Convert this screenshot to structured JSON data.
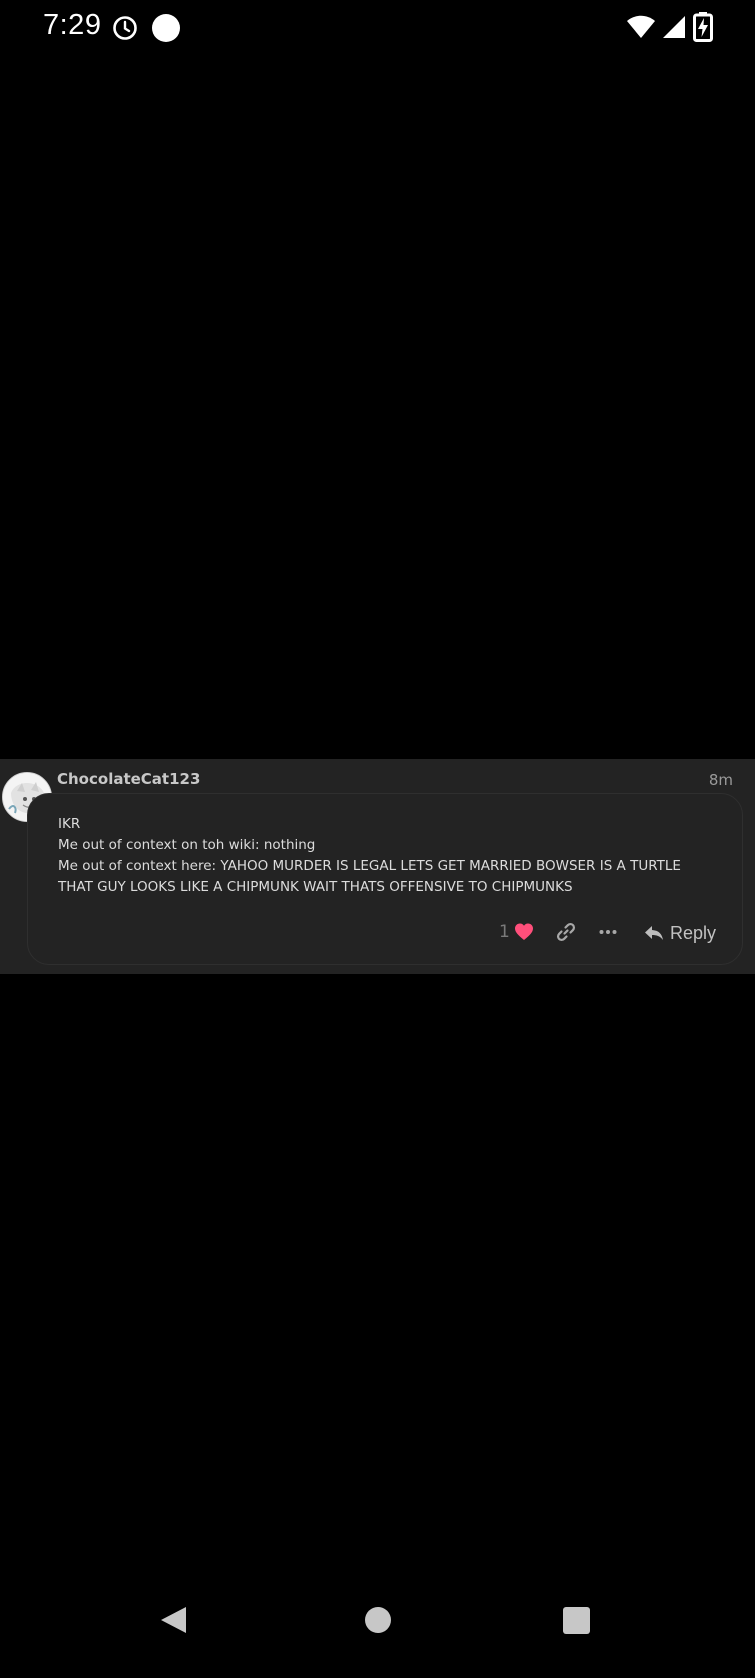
{
  "status_bar": {
    "time": "7:29",
    "icons": [
      "clock-icon",
      "notification-dot-icon",
      "wifi-icon",
      "cell-signal-icon",
      "battery-charging-icon"
    ]
  },
  "comment": {
    "username": "ChocolateCat123",
    "timestamp": "8m",
    "body_lines": [
      "IKR",
      "Me out of context on toh wiki: nothing",
      "Me out of context here: YAHOO MURDER IS LEGAL LETS GET MARRIED BOWSER IS A TURTLE THAT GUY LOOKS LIKE A CHIPMUNK WAIT THATS OFFENSIVE TO CHIPMUNKS"
    ],
    "like_count": "1",
    "reply_label": "Reply",
    "colors": {
      "heart": "#ff4f7b",
      "card_background": "#232323",
      "username": "#c8c8c8"
    }
  },
  "nav_bar": {
    "icons": [
      "back-icon",
      "home-icon",
      "recents-icon"
    ]
  }
}
